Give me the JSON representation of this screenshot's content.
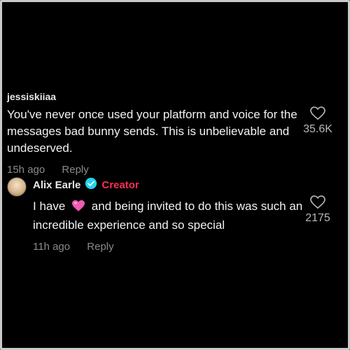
{
  "comments": [
    {
      "username": "jessiskiiaa",
      "text": "You've never once used your platform and voice for the messages bad bunny sends. This is unbelievable and undeserved.",
      "time": "15h ago",
      "reply": "Reply",
      "likes": "35.6K",
      "icon": "heart-outline-icon"
    },
    {
      "username": "Alix Earle",
      "badge": "Creator",
      "text_before": "I have",
      "emoji": "pink-heart-emoji",
      "text_after": "and being invited to do this was such an incredible experience and so special",
      "time": "11h ago",
      "reply": "Reply",
      "likes": "2175",
      "icon": "heart-outline-icon"
    }
  ],
  "colors": {
    "background": "#000000",
    "creator_badge": "#fe2c55",
    "verified": "#20d5ec",
    "meta_text": "#8a8a8a"
  }
}
